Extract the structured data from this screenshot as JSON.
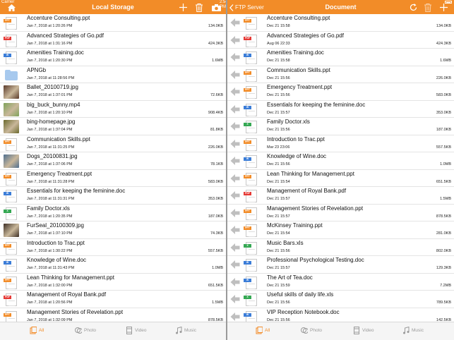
{
  "status": {
    "carrier": "Carrier",
    "time": "2:54 PM"
  },
  "left": {
    "title": "Local Storage",
    "items": [
      {
        "name": "Accenture Consulting.ppt",
        "date": "Jan 7, 2018 at 1:20:26 PM",
        "size": "134.0KB",
        "icon": "ppt"
      },
      {
        "name": "Advanced Strategies of Go.pdf",
        "date": "Jan 7, 2018 at 1:31:16 PM",
        "size": "424.3KB",
        "icon": "pdf"
      },
      {
        "name": "Amenities Training.doc",
        "date": "Jan 7, 2018 at 1:20:30 PM",
        "size": "1.6MB",
        "icon": "doc"
      },
      {
        "name": "APNGb",
        "date": "Jan 7, 2018 at 11:28:56 PM",
        "size": "",
        "icon": "folder"
      },
      {
        "name": "Ballet_20100719.jpg",
        "date": "Jan 7, 2018 at 1:37:01 PM",
        "size": "72.6KB",
        "icon": "photo",
        "color": "#5a3a2a"
      },
      {
        "name": "big_buck_bunny.mp4",
        "date": "Jan 7, 2018 at 1:20:10 PM",
        "size": "908.4KB",
        "icon": "photo",
        "color": "#7fa35a"
      },
      {
        "name": "bing-homepage.jpg",
        "date": "Jan 7, 2018 at 1:37:04 PM",
        "size": "81.8KB",
        "icon": "photo",
        "color": "#6b6a2e"
      },
      {
        "name": "Communication Skills.ppt",
        "date": "Jan 7, 2018 at 11:31:25 PM",
        "size": "226.0KB",
        "icon": "ppt"
      },
      {
        "name": "Dogs_20100831.jpg",
        "date": "Jan 7, 2018 at 1:37:06 PM",
        "size": "78.1KB",
        "icon": "photo",
        "color": "#4f6f8f"
      },
      {
        "name": "Emergency Treatment.ppt",
        "date": "Jan 7, 2018 at 11:31:28 PM",
        "size": "583.0KB",
        "icon": "ppt"
      },
      {
        "name": "Essentials for keeping the feminine.doc",
        "date": "Jan 7, 2018 at 11:31:31 PM",
        "size": "353.0KB",
        "icon": "doc"
      },
      {
        "name": "Family Doctor.xls",
        "date": "Jan 7, 2018 at 1:20:35 PM",
        "size": "187.0KB",
        "icon": "xls"
      },
      {
        "name": "FurSeal_20100309.jpg",
        "date": "Jan 7, 2018 at 1:37:10 PM",
        "size": "74.3KB",
        "icon": "photo",
        "color": "#3d2f25"
      },
      {
        "name": "Introduction to Trac.ppt",
        "date": "Jan 7, 2018 at 1:30:22 PM",
        "size": "557.5KB",
        "icon": "ppt"
      },
      {
        "name": "Knowledge of Wine.doc",
        "date": "Jan 7, 2018 at 11:31:43 PM",
        "size": "1.0MB",
        "icon": "doc"
      },
      {
        "name": "Lean Thinking for Management.ppt",
        "date": "Jan 7, 2018 at 1:32:00 PM",
        "size": "651.5KB",
        "icon": "ppt"
      },
      {
        "name": "Management of Royal Bank.pdf",
        "date": "Jan 7, 2018 at 1:20:56 PM",
        "size": "1.5MB",
        "icon": "pdf"
      },
      {
        "name": "Management Stories of Revelation.ppt",
        "date": "Jan 7, 2018 at 1:32:09 PM",
        "size": "878.5KB",
        "icon": "ppt"
      }
    ]
  },
  "right": {
    "back_label": "FTP Server",
    "title": "Document",
    "items": [
      {
        "name": "Accenture Consulting.ppt",
        "date": "Dec 21 15:58",
        "size": "134.0KB",
        "icon": "ppt"
      },
      {
        "name": "Advanced Strategies of Go.pdf",
        "date": "Aug 06 22:33",
        "size": "424.3KB",
        "icon": "pdf"
      },
      {
        "name": "Amenities Training.doc",
        "date": "Dec 21 15:58",
        "size": "1.6MB",
        "icon": "doc"
      },
      {
        "name": "Communication Skills.ppt",
        "date": "Dec 21 15:56",
        "size": "226.0KB",
        "icon": "ppt"
      },
      {
        "name": "Emergency Treatment.ppt",
        "date": "Dec 21 15:56",
        "size": "583.0KB",
        "icon": "ppt"
      },
      {
        "name": "Essentials for keeping the feminine.doc",
        "date": "Dec 21 15:57",
        "size": "353.0KB",
        "icon": "doc"
      },
      {
        "name": "Family Doctor.xls",
        "date": "Dec 21 15:56",
        "size": "187.0KB",
        "icon": "xls"
      },
      {
        "name": "Introduction to Trac.ppt",
        "date": "Mar 23 23:06",
        "size": "557.5KB",
        "icon": "ppt"
      },
      {
        "name": "Knowledge of Wine.doc",
        "date": "Dec 21 15:56",
        "size": "1.0MB",
        "icon": "doc"
      },
      {
        "name": "Lean Thinking for Management.ppt",
        "date": "Dec 21 15:54",
        "size": "651.5KB",
        "icon": "ppt"
      },
      {
        "name": "Management of Royal Bank.pdf",
        "date": "Dec 21 15:57",
        "size": "1.5MB",
        "icon": "pdf"
      },
      {
        "name": "Management Stories of Revelation.ppt",
        "date": "Dec 21 15:57",
        "size": "878.5KB",
        "icon": "ppt"
      },
      {
        "name": "McKinsey Training.ppt",
        "date": "Dec 21 15:54",
        "size": "281.0KB",
        "icon": "ppt"
      },
      {
        "name": "Music Bars.xls",
        "date": "Dec 21 15:56",
        "size": "802.0KB",
        "icon": "xls"
      },
      {
        "name": "Professional Psychological Testing.doc",
        "date": "Dec 21 15:57",
        "size": "129.3KB",
        "icon": "doc"
      },
      {
        "name": "The Art of Tea.doc",
        "date": "Dec 21 15:59",
        "size": "7.2MB",
        "icon": "doc"
      },
      {
        "name": "Useful skills of daily life.xls",
        "date": "Dec 21 15:56",
        "size": "789.5KB",
        "icon": "xls"
      },
      {
        "name": "VIP Reception Notebook.doc",
        "date": "Dec 21 15:56",
        "size": "142.5KB",
        "icon": "doc"
      }
    ]
  },
  "tabs": [
    {
      "label": "All",
      "icon": "all-files-icon",
      "active": true
    },
    {
      "label": "Photo",
      "icon": "photo-icon",
      "active": false
    },
    {
      "label": "Video",
      "icon": "video-icon",
      "active": false
    },
    {
      "label": "Music",
      "icon": "music-icon",
      "active": false
    }
  ],
  "colors": {
    "accent": "#f28c28",
    "ppt": "#f28c28",
    "pdf": "#e53935",
    "doc": "#3b7dd8",
    "xls": "#35a853"
  }
}
